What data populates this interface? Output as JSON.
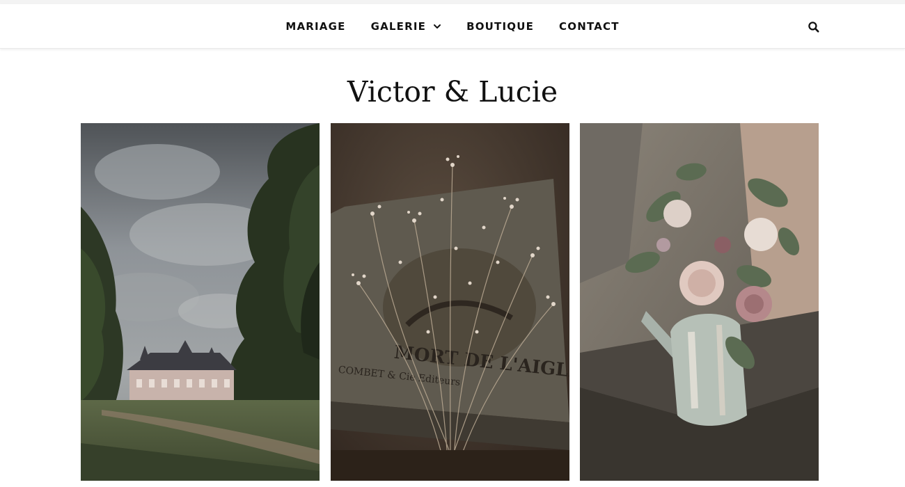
{
  "nav": {
    "items": [
      {
        "label": "MARIAGE"
      },
      {
        "label": "GALERIE",
        "icon": "chevron-down-icon"
      },
      {
        "label": "BOUTIQUE"
      },
      {
        "label": "CONTACT"
      }
    ],
    "search_icon": "search-icon"
  },
  "main": {
    "title": "Victor & Lucie"
  },
  "colors": {
    "text": "#111111",
    "background": "#ffffff",
    "nav_border": "#e9e9e9"
  }
}
